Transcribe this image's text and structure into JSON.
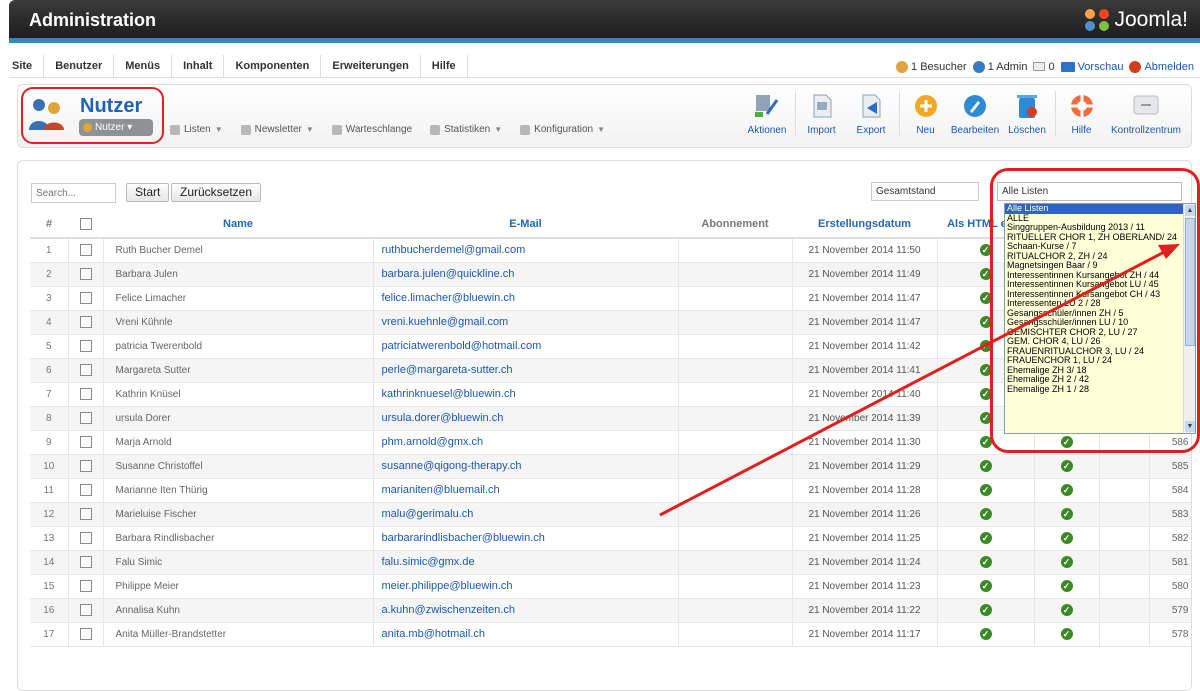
{
  "header": {
    "title": "Administration",
    "logo_text": "Joomla!"
  },
  "menu": {
    "items": [
      "Site",
      "Benutzer",
      "Menüs",
      "Inhalt",
      "Komponenten",
      "Erweiterungen",
      "Hilfe"
    ],
    "status": {
      "visitors": "1 Besucher",
      "admins": "1 Admin",
      "messages": "0",
      "preview": "Vorschau",
      "logout": "Abmelden"
    }
  },
  "component": {
    "title": "Nutzer",
    "button": "Nutzer",
    "submenu": [
      {
        "label": "Listen",
        "caret": true
      },
      {
        "label": "Newsletter",
        "caret": true
      },
      {
        "label": "Warteschlange",
        "caret": false
      },
      {
        "label": "Statistiken",
        "caret": true
      },
      {
        "label": "Konfiguration",
        "caret": true
      }
    ]
  },
  "toolbar": {
    "actions": "Aktionen",
    "import": "Import",
    "export": "Export",
    "new": "Neu",
    "edit": "Bearbeiten",
    "delete": "Löschen",
    "help": "Hilfe",
    "control": "Kontrollzentrum"
  },
  "filters": {
    "search_placeholder": "Search...",
    "start": "Start",
    "reset": "Zurücksetzen",
    "status_selected": "Gesamtstand",
    "lists_selected": "Alle Listen"
  },
  "table": {
    "headers": {
      "num": "#",
      "name": "Name",
      "email": "E-Mail",
      "subscription": "Abonnement",
      "created": "Erstellungsdatum",
      "html": "Als HTML erha"
    },
    "rows": [
      {
        "n": "1",
        "name": "Ruth Bucher Demel",
        "email": "ruthbucherdemel@gmail.com",
        "date": "21 November 2014 11:50",
        "id": ""
      },
      {
        "n": "2",
        "name": "Barbara Julen",
        "email": "barbara.julen@quickline.ch",
        "date": "21 November 2014 11:49",
        "id": ""
      },
      {
        "n": "3",
        "name": "Felice Limacher",
        "email": "felice.limacher@bluewin.ch",
        "date": "21 November 2014 11:47",
        "id": ""
      },
      {
        "n": "4",
        "name": "Vreni Kühnle",
        "email": "vreni.kuehnle@gmail.com",
        "date": "21 November 2014 11:47",
        "id": ""
      },
      {
        "n": "5",
        "name": "patricia Twerenbold",
        "email": "patriciatwerenbold@hotmail.com",
        "date": "21 November 2014 11:42",
        "id": ""
      },
      {
        "n": "6",
        "name": "Margareta Sutter",
        "email": "perle@margareta-sutter.ch",
        "date": "21 November 2014 11:41",
        "id": ""
      },
      {
        "n": "7",
        "name": "Kathrin Knüsel",
        "email": "kathrinknuesel@bluewin.ch",
        "date": "21 November 2014 11:40",
        "id": ""
      },
      {
        "n": "8",
        "name": "ursula Dorer",
        "email": "ursula.dorer@bluewin.ch",
        "date": "21 November 2014 11:39",
        "id": "587"
      },
      {
        "n": "9",
        "name": "Marja Arnold",
        "email": "phm.arnold@gmx.ch",
        "date": "21 November 2014 11:30",
        "id": "586"
      },
      {
        "n": "10",
        "name": "Susanne Christoffel",
        "email": "susanne@qigong-therapy.ch",
        "date": "21 November 2014 11:29",
        "id": "585"
      },
      {
        "n": "11",
        "name": "Marianne Iten Thürig",
        "email": "marianiten@bluemail.ch",
        "date": "21 November 2014 11:28",
        "id": "584"
      },
      {
        "n": "12",
        "name": "Marieluise Fischer",
        "email": "malu@gerimalu.ch",
        "date": "21 November 2014 11:26",
        "id": "583"
      },
      {
        "n": "13",
        "name": "Barbara Rindlisbacher",
        "email": "barbararindlisbacher@bluewin.ch",
        "date": "21 November 2014 11:25",
        "id": "582"
      },
      {
        "n": "14",
        "name": "Falu Simic",
        "email": "falu.simic@gmx.de",
        "date": "21 November 2014 11:24",
        "id": "581"
      },
      {
        "n": "15",
        "name": "Philippe Meier",
        "email": "meier.philippe@bluewin.ch",
        "date": "21 November 2014 11:23",
        "id": "580"
      },
      {
        "n": "16",
        "name": "Annalisa Kuhn",
        "email": "a.kuhn@zwischenzeiten.ch",
        "date": "21 November 2014 11:22",
        "id": "579"
      },
      {
        "n": "17",
        "name": "Anita Müller-Brandstetter",
        "email": "anita.mb@hotmail.ch",
        "date": "21 November 2014 11:17",
        "id": "578"
      }
    ]
  },
  "dropdown": {
    "options": [
      "Alle Listen",
      "ALLE",
      "Singgruppen-Ausbildung 2013 / 11",
      "RITUELLER CHOR 1, ZH OBERLAND/ 24",
      "Schaan-Kurse / 7",
      "RITUALCHOR 2, ZH / 24",
      "Magnetsingen Baar / 9",
      "Interessentinnen Kursangebot ZH / 44",
      "Interessentinnen Kursangebot LU / 45",
      "Interessentinnen Kursangebot CH / 43",
      "Interessenten LU 2 / 28",
      "Gesangsschüler/innen ZH / 5",
      "Gesangsschüler/innen LU / 10",
      "GEMISCHTER CHOR 2, LU / 27",
      "GEM. CHOR 4, LU / 26",
      "FRAUENRITUALCHOR 3, LU / 24",
      "FRAUENCHOR 1, LU / 24",
      "Ehemalige ZH 3/ 18",
      "Ehemalige ZH 2 / 42",
      "Ehemalige ZH 1 / 28"
    ]
  },
  "colors": {
    "accent": "#2f8ac9",
    "link": "#1b57b1",
    "highlight": "#e21e1e",
    "ok": "#3c8a25"
  }
}
